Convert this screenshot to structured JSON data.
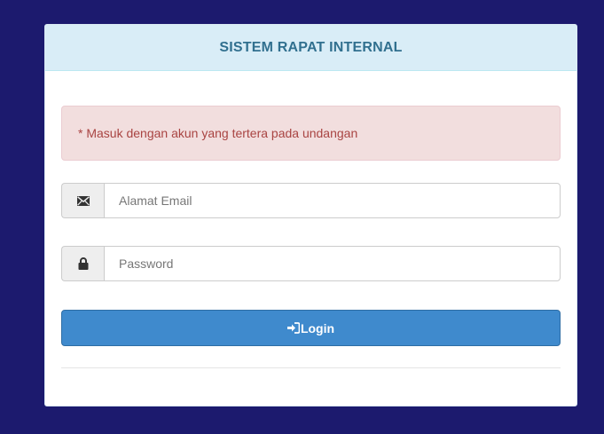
{
  "panel": {
    "title": "SISTEM RAPAT INTERNAL"
  },
  "alert": {
    "message": "* Masuk dengan akun yang tertera pada undangan"
  },
  "email": {
    "placeholder": "Alamat Email",
    "value": "",
    "icon": "envelope-icon"
  },
  "password": {
    "placeholder": "Password",
    "value": "",
    "icon": "lock-icon"
  },
  "login": {
    "label": "Login",
    "icon": "log-in-icon"
  },
  "colors": {
    "background": "#1c1a6e",
    "heading_bg": "#d9edf7",
    "heading_text": "#31708f",
    "alert_bg": "#f2dede",
    "alert_text": "#a94442",
    "button_bg": "#3f8acd"
  }
}
